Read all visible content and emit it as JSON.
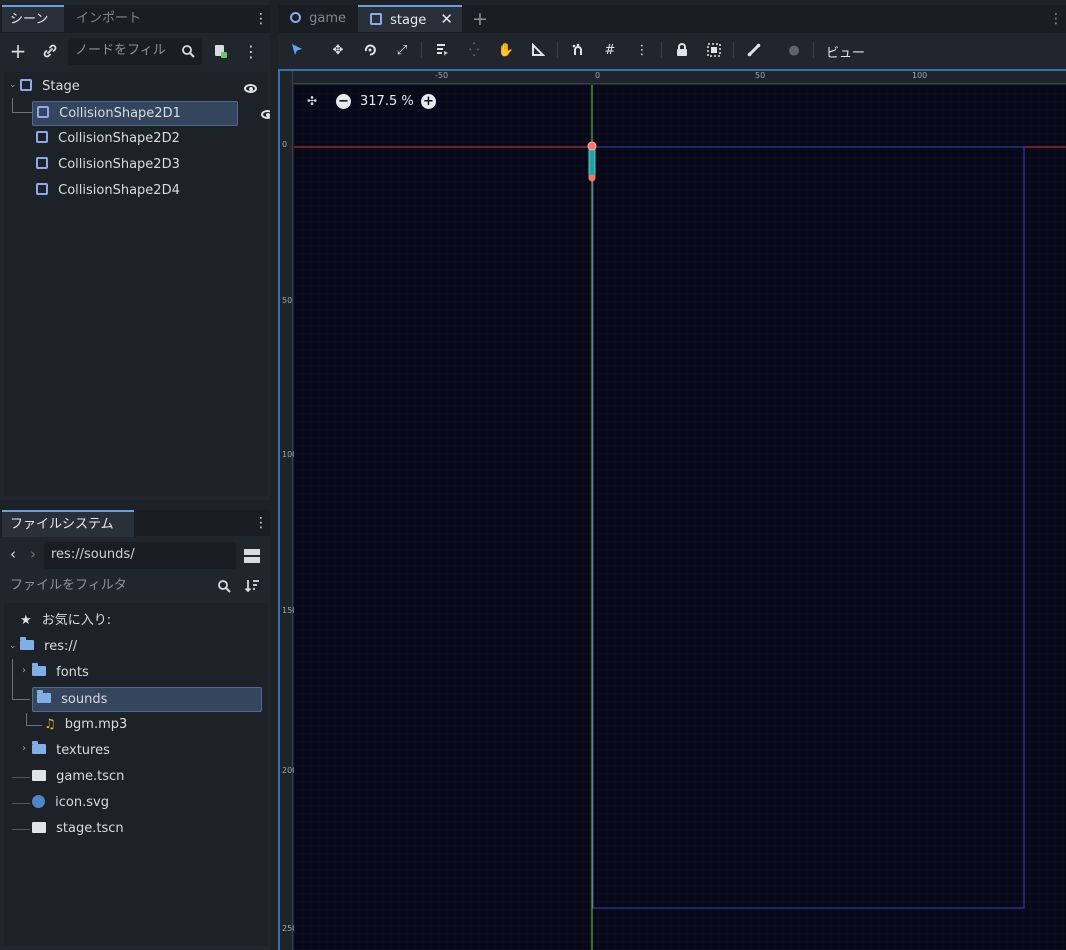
{
  "scene_dock": {
    "tabs": [
      {
        "label": "シーン"
      },
      {
        "label": "インポート"
      }
    ],
    "filter_placeholder": "ノードをフィル",
    "nodes": [
      {
        "label": "Stage"
      },
      {
        "label": "CollisionShape2D1"
      },
      {
        "label": "CollisionShape2D2"
      },
      {
        "label": "CollisionShape2D3"
      },
      {
        "label": "CollisionShape2D4"
      }
    ]
  },
  "filesystem_dock": {
    "tab": "ファイルシステム",
    "path": "res://sounds/",
    "filter_placeholder": "ファイルをフィルタ",
    "favorites_label": "お気に入り:",
    "items": [
      {
        "label": "res://"
      },
      {
        "label": "fonts"
      },
      {
        "label": "sounds"
      },
      {
        "label": "bgm.mp3"
      },
      {
        "label": "textures"
      },
      {
        "label": "game.tscn"
      },
      {
        "label": "icon.svg"
      },
      {
        "label": "stage.tscn"
      }
    ]
  },
  "editor_tabs": [
    {
      "label": "game"
    },
    {
      "label": "stage"
    }
  ],
  "toolbar": {
    "view_label": "ビュー"
  },
  "viewport": {
    "zoom_label": "317.5 %",
    "ruler_top": [
      "-50",
      "0",
      "50",
      "100"
    ],
    "ruler_left": [
      "0",
      "50",
      "100",
      "150",
      "200",
      "250"
    ]
  },
  "colors": {
    "accent": "#6d9fd8",
    "selection": "#34455d",
    "viewport_bg": "#070818",
    "x_axis": "#d63a3a",
    "y_axis": "#7fcf3f",
    "frame": "#4040b8"
  }
}
